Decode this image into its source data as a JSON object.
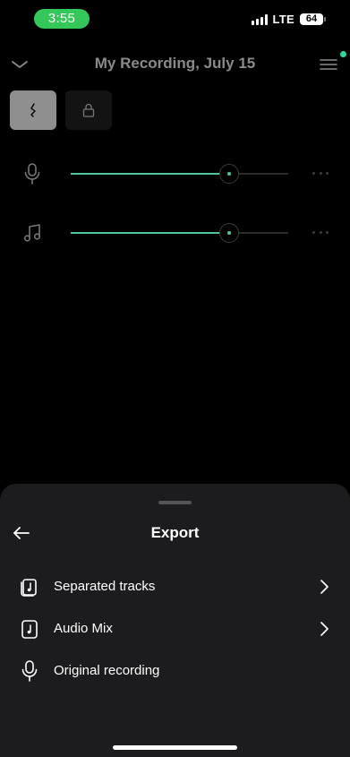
{
  "status_bar": {
    "time": "3:55",
    "network": "LTE",
    "battery": "64"
  },
  "header": {
    "title": "My Recording, July 15",
    "collapse_icon": "chevron-down-icon",
    "menu_icon": "hamburger-menu-icon"
  },
  "modes": [
    {
      "icon": "pitch-mark-icon",
      "active": true
    },
    {
      "icon": "lock-icon",
      "active": false
    }
  ],
  "tracks": [
    {
      "icon": "microphone-icon",
      "level": 0.73
    },
    {
      "icon": "music-note-icon",
      "level": 0.73
    }
  ],
  "colors": {
    "accent": "#4ec79a",
    "status_pill": "#34c759",
    "sheet_bg": "#1c1c1e"
  },
  "export_sheet": {
    "title": "Export",
    "options": [
      {
        "label": "Separated tracks",
        "icon": "stacked-music-file-icon",
        "has_chevron": true
      },
      {
        "label": "Audio Mix",
        "icon": "music-file-icon",
        "has_chevron": true
      },
      {
        "label": "Original recording",
        "icon": "microphone-icon",
        "has_chevron": false
      }
    ]
  }
}
